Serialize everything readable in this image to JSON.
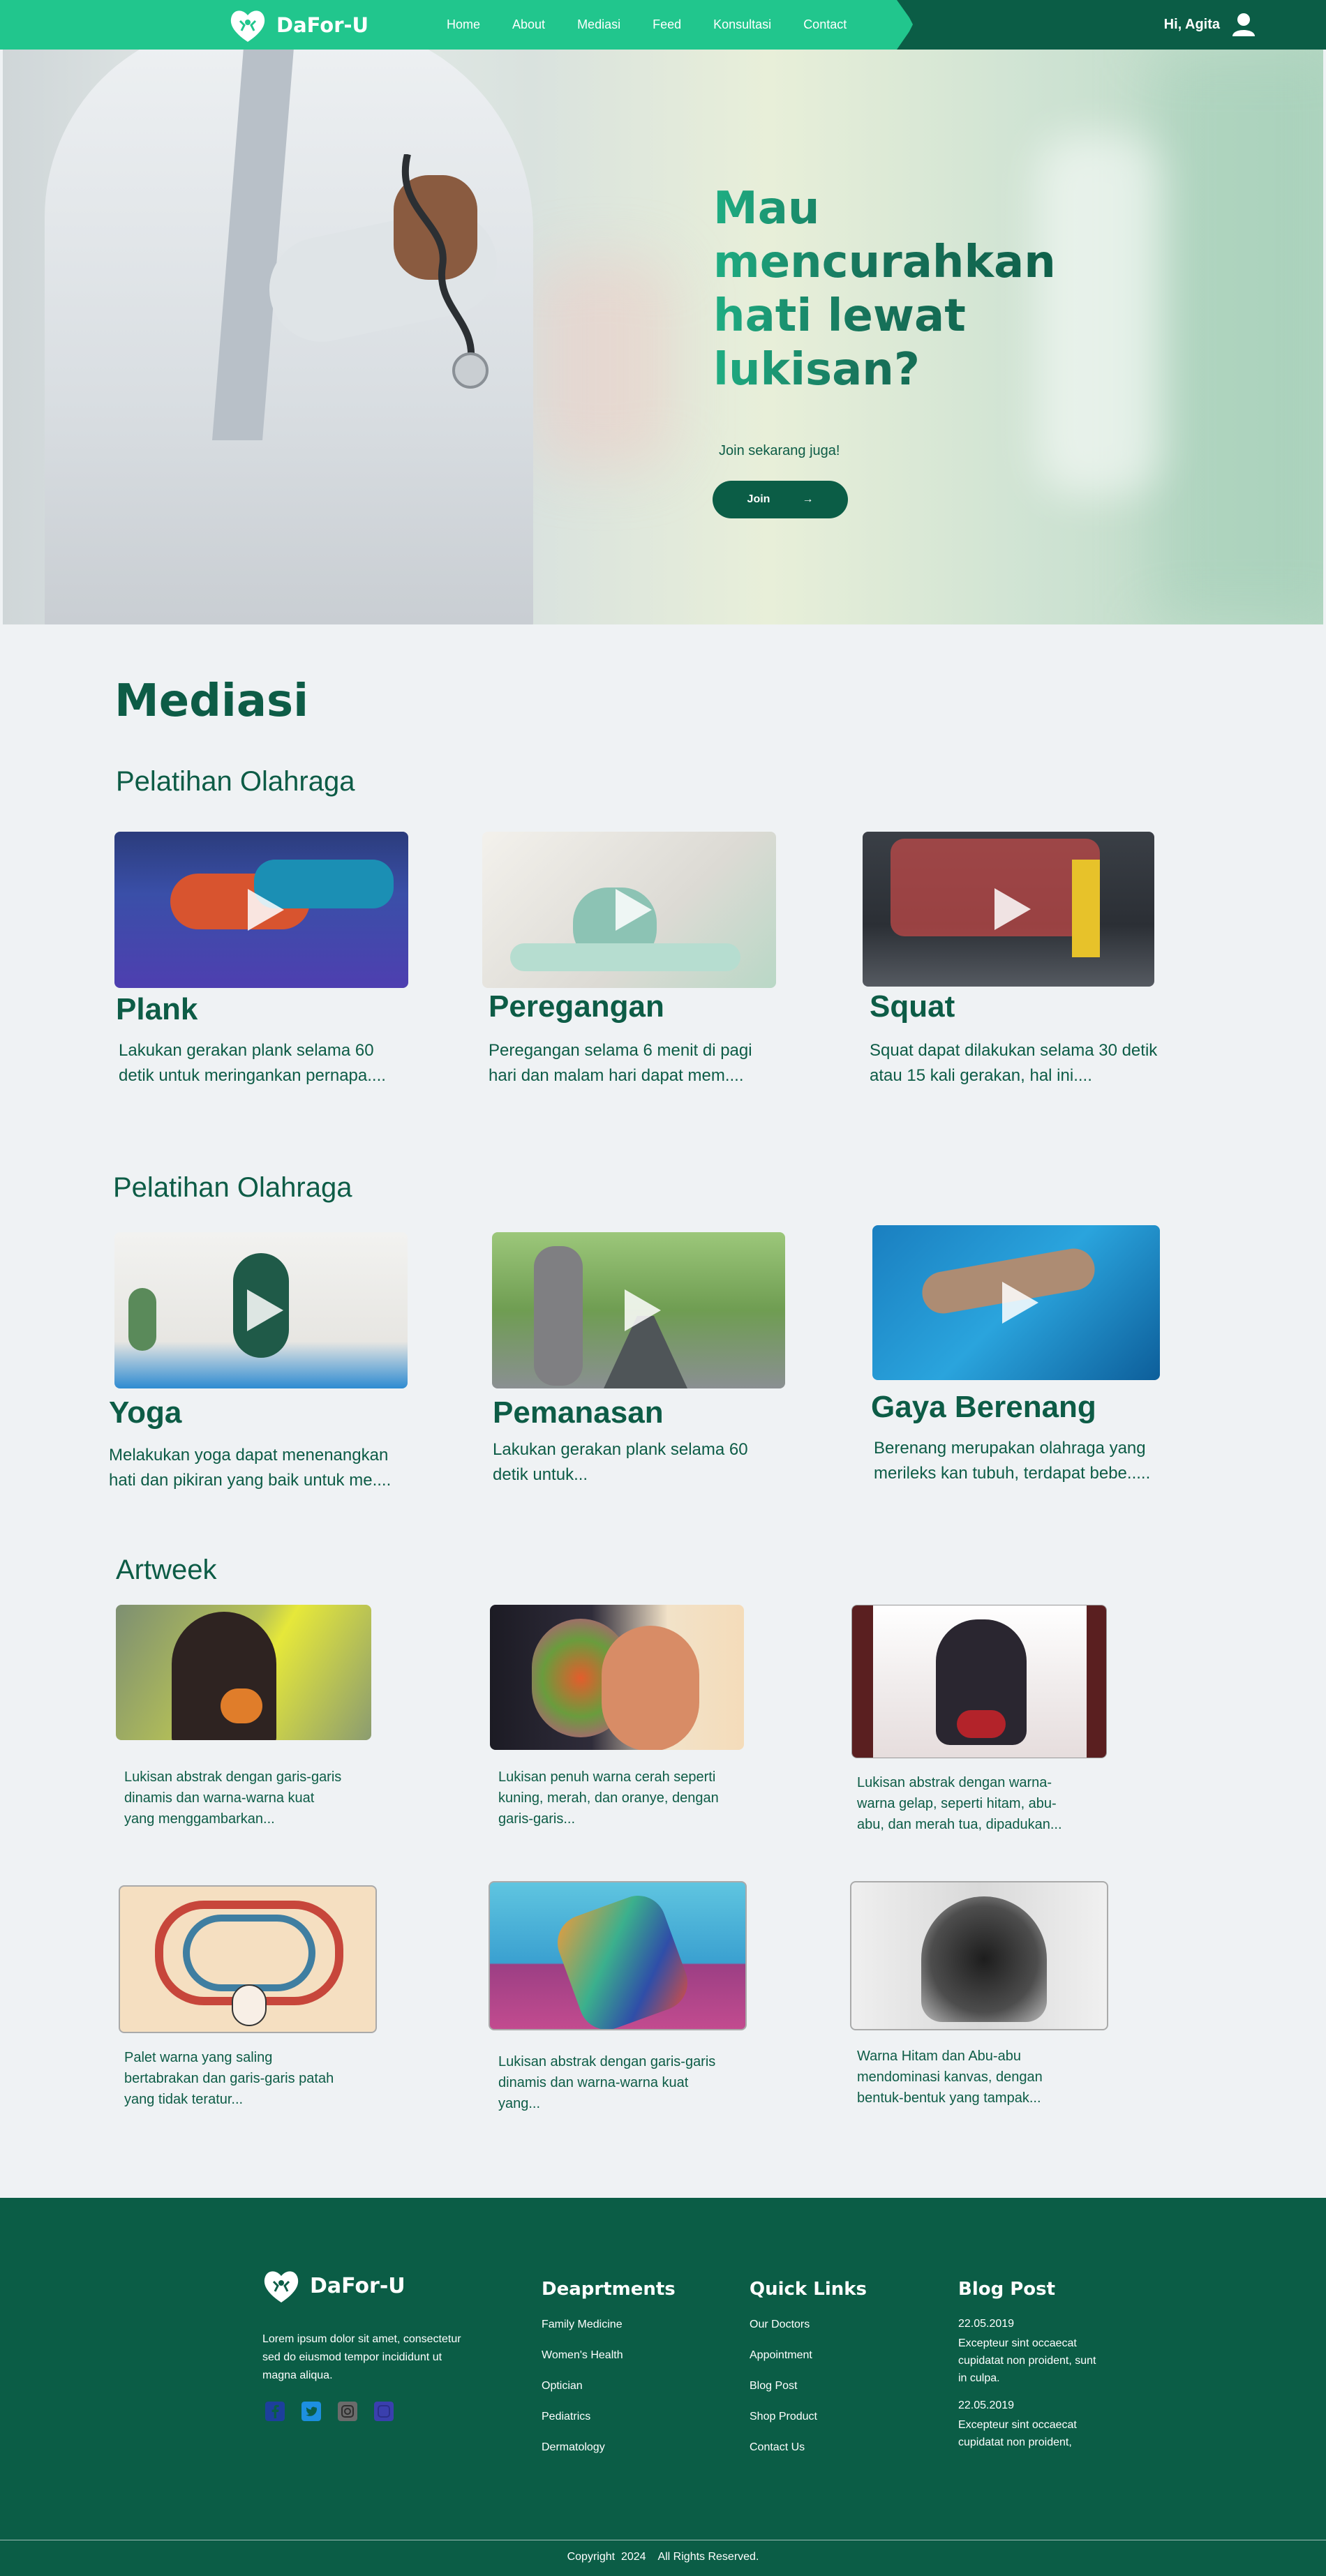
{
  "nav": {
    "brand": "DaFor-U",
    "links": [
      "Home",
      "About",
      "Mediasi",
      "Feed",
      "Konsultasi",
      "Contact"
    ],
    "greeting": "Hi, Agita"
  },
  "hero": {
    "title": "Mau mencurahkan hati lewat lukisan?",
    "subtitle": "Join sekarang juga!",
    "button_label": "Join",
    "button_arrow": "→"
  },
  "mediasi": {
    "title": "Mediasi",
    "group1_title": "Pelatihan Olahraga",
    "group1": [
      {
        "title": "Plank",
        "desc": "Lakukan gerakan plank selama 60 detik untuk meringankan pernapa...."
      },
      {
        "title": "Peregangan",
        "desc": "Peregangan selama 6 menit di pagi hari dan malam hari dapat mem...."
      },
      {
        "title": "Squat",
        "desc": "Squat dapat dilakukan selama 30 detik atau 15 kali gerakan, hal ini...."
      }
    ],
    "group2_title": "Pelatihan Olahraga",
    "group2": [
      {
        "title": "Yoga",
        "desc": "Melakukan yoga dapat menenangkan hati dan pikiran yang baik untuk me...."
      },
      {
        "title": "Pemanasan",
        "desc": "Lakukan gerakan plank selama 60 detik untuk..."
      },
      {
        "title": "Gaya Berenang",
        "desc": "Berenang merupakan olahraga yang merileks kan tubuh, terdapat bebe....."
      }
    ]
  },
  "artweek": {
    "title": "Artweek",
    "items": [
      "Lukisan abstrak dengan garis-garis dinamis dan warna-warna kuat yang menggambarkan...",
      "Lukisan penuh warna cerah seperti kuning, merah, dan oranye, dengan garis-garis...",
      "Lukisan abstrak dengan warna-warna gelap, seperti hitam, abu-abu, dan merah tua, dipadukan...",
      "Palet warna yang saling bertabrakan dan garis-garis patah yang tidak teratur...",
      "Lukisan abstrak dengan garis-garis dinamis dan warna-warna kuat yang...",
      "Warna Hitam dan Abu-abu mendominasi kanvas, dengan bentuk-bentuk yang tampak..."
    ]
  },
  "footer": {
    "brand": "DaFor-U",
    "about": "Lorem ipsum dolor sit amet, consectetur sed do eiusmod tempor incididunt ut magna aliqua.",
    "departments_title": "Deaprtments",
    "departments": [
      "Family Medicine",
      "Women's Health",
      "Optician",
      "Pediatrics",
      "Dermatology"
    ],
    "quicklinks_title": "Quick Links",
    "quicklinks": [
      "Our Doctors",
      "Appointment",
      "Blog Post",
      "Shop Product",
      "Contact Us"
    ],
    "blog_title": "Blog Post",
    "blog": [
      {
        "date": "22.05.2019",
        "text": "Excepteur sint occaecat cupidatat non proident, sunt in culpa."
      },
      {
        "date": "22.05.2019",
        "text": "Excepteur sint occaecat cupidatat non proident,"
      }
    ],
    "copyright": "Copyright  2024    All Rights Reserved."
  },
  "colors": {
    "primary": "#0b5d46",
    "accent": "#21c68d",
    "background": "#eff2f4"
  },
  "icons": {
    "logo": "heart-hands-icon",
    "user": "user-icon",
    "play": "play-icon",
    "socials": [
      "facebook-icon",
      "twitter-icon",
      "instagram-icon",
      "linkedin-icon"
    ]
  }
}
